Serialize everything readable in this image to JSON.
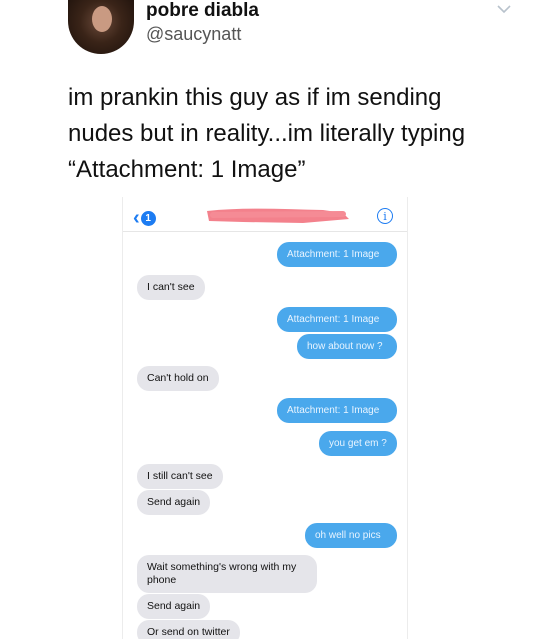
{
  "tweet": {
    "author_name": "pobre diabla",
    "author_handle": "@saucynatt",
    "text_lines": [
      "im prankin this guy as if im sending",
      "nudes but in reality...im literally typing",
      "“Attachment: 1 Image”"
    ]
  },
  "screenshot": {
    "unread_badge": "1",
    "info_glyph": "i",
    "messages": [
      {
        "side": "sent",
        "text": "Attachment: 1 Image"
      },
      {
        "side": "recv",
        "text": "I can't see"
      },
      {
        "side": "sent",
        "text": "Attachment: 1 Image"
      },
      {
        "side": "sent",
        "text": "how about now ?"
      },
      {
        "side": "recv",
        "text": "Can't hold on"
      },
      {
        "side": "sent",
        "text": "Attachment: 1 Image"
      },
      {
        "side": "sent",
        "text": "you get em ?"
      },
      {
        "side": "recv",
        "text": "I still can't see"
      },
      {
        "side": "recv",
        "text": "Send again"
      },
      {
        "side": "sent",
        "text": "oh well no pics"
      },
      {
        "side": "recv",
        "text": "Wait something's wrong with my phone"
      },
      {
        "side": "recv",
        "text": "Send again"
      },
      {
        "side": "recv",
        "text": "Or send on twitter"
      }
    ]
  },
  "colors": {
    "sent_bubble": "#4aa8ec",
    "received_bubble": "#e5e5ea",
    "ios_blue": "#1d7cf2",
    "redaction": "#f27a86"
  }
}
